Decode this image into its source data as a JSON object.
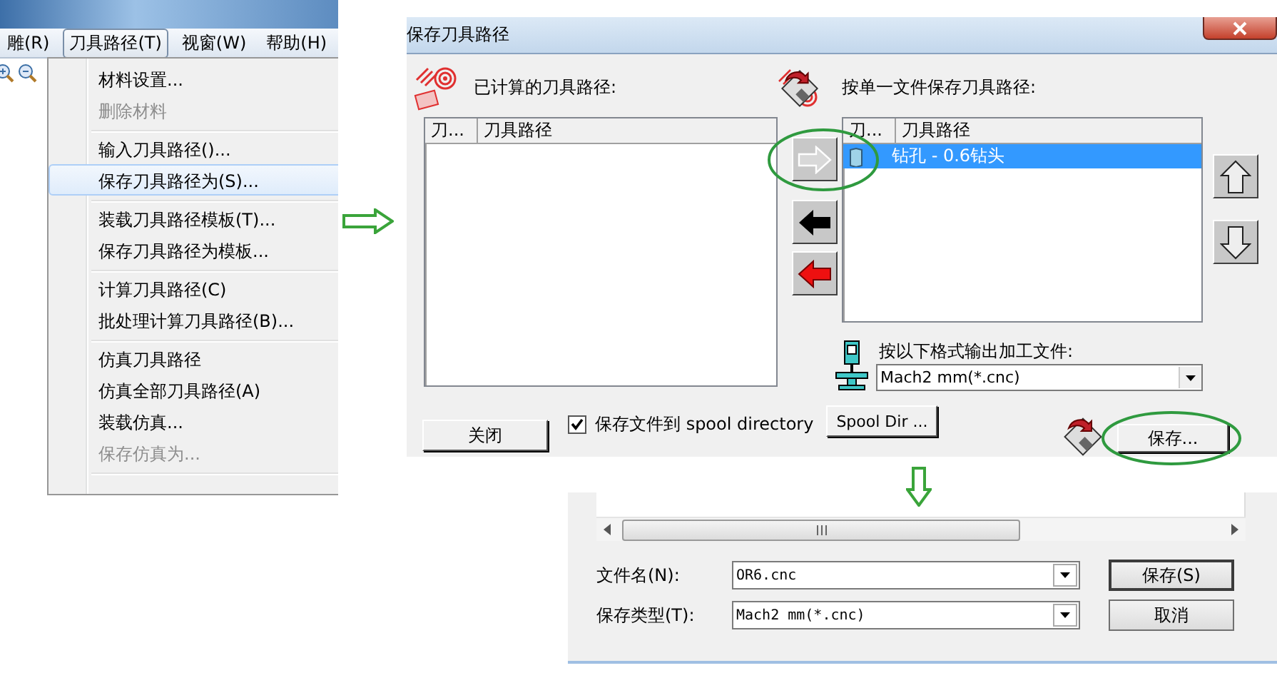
{
  "menu_window": {
    "menubar": [
      {
        "label": "雕(R)",
        "selected": false
      },
      {
        "label": "刀具路径(T)",
        "selected": true
      },
      {
        "label": "视窗(W)",
        "selected": false
      },
      {
        "label": "帮助(H)",
        "selected": false
      }
    ],
    "menu_groups": [
      [
        {
          "label": "材料设置...",
          "disabled": false,
          "selected": false
        },
        {
          "label": "删除材料",
          "disabled": true,
          "selected": false
        }
      ],
      [
        {
          "label": "输入刀具路径()...",
          "disabled": false,
          "selected": false
        },
        {
          "label": "保存刀具路径为(S)...",
          "disabled": false,
          "selected": true
        }
      ],
      [
        {
          "label": "装载刀具路径模板(T)...",
          "disabled": false,
          "selected": false
        },
        {
          "label": "保存刀具路径为模板...",
          "disabled": false,
          "selected": false
        }
      ],
      [
        {
          "label": "计算刀具路径(C)",
          "disabled": false,
          "selected": false
        },
        {
          "label": "批处理计算刀具路径(B)...",
          "disabled": false,
          "selected": false
        }
      ],
      [
        {
          "label": "仿真刀具路径",
          "disabled": false,
          "selected": false
        },
        {
          "label": "仿真全部刀具路径(A)",
          "disabled": false,
          "selected": false
        },
        {
          "label": "装载仿真...",
          "disabled": false,
          "selected": false
        },
        {
          "label": "保存仿真为...",
          "disabled": true,
          "selected": false
        }
      ]
    ]
  },
  "save_toolpaths_dialog": {
    "title": "保存刀具路径",
    "calculated_label": "已计算的刀具路径:",
    "calculated_columns": [
      "刀...",
      "刀具路径"
    ],
    "single_file_label": "按单一文件保存刀具路径:",
    "single_file_columns": [
      "刀...",
      "刀具路径"
    ],
    "single_file_rows": [
      {
        "name": "钻孔 - 0.6钻头",
        "selected": true
      }
    ],
    "output_format_label": "按以下格式输出加工文件:",
    "output_format_value": "Mach2 mm(*.cnc)",
    "close_button": "关闭",
    "spool_checkbox": {
      "label": "保存文件到 spool directory",
      "checked": true
    },
    "spool_dir_button": "Spool Dir ...",
    "save_button": "保存..."
  },
  "file_save_dialog": {
    "file_name_label": "文件名(N):",
    "file_name_value": "OR6.cnc",
    "file_type_label": "保存类型(T):",
    "file_type_value": "Mach2 mm(*.cnc)",
    "save_button": "保存(S)",
    "cancel_button": "取消"
  }
}
